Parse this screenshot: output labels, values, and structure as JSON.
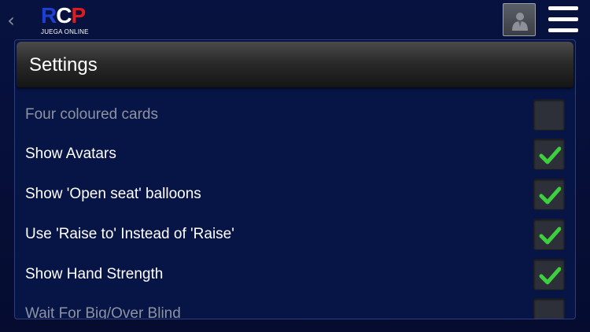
{
  "header": {
    "back_icon": "chevron-left-icon",
    "logo": {
      "letters": [
        "R",
        "C",
        "P"
      ],
      "subtitle": "JUEGA ONLINE",
      "colors": [
        "#1c3fd6",
        "#ffffff",
        "#e01b1b"
      ]
    },
    "avatar_icon": "user-avatar-icon",
    "menu_icon": "hamburger-menu-icon"
  },
  "settings": {
    "title": "Settings",
    "items": [
      {
        "label": "Four coloured cards",
        "checked": false,
        "enabled": false
      },
      {
        "label": "Show Avatars",
        "checked": true,
        "enabled": true
      },
      {
        "label": "Show 'Open seat' balloons",
        "checked": true,
        "enabled": true
      },
      {
        "label": "Use 'Raise to' Instead of 'Raise'",
        "checked": true,
        "enabled": true
      },
      {
        "label": "Show Hand Strength",
        "checked": true,
        "enabled": true
      },
      {
        "label": "Wait For Big/Over Blind",
        "checked": false,
        "enabled": false
      }
    ]
  },
  "colors": {
    "background": "#06103a",
    "check": "#3dcf3d",
    "disabled_text": "#8e93a1"
  }
}
